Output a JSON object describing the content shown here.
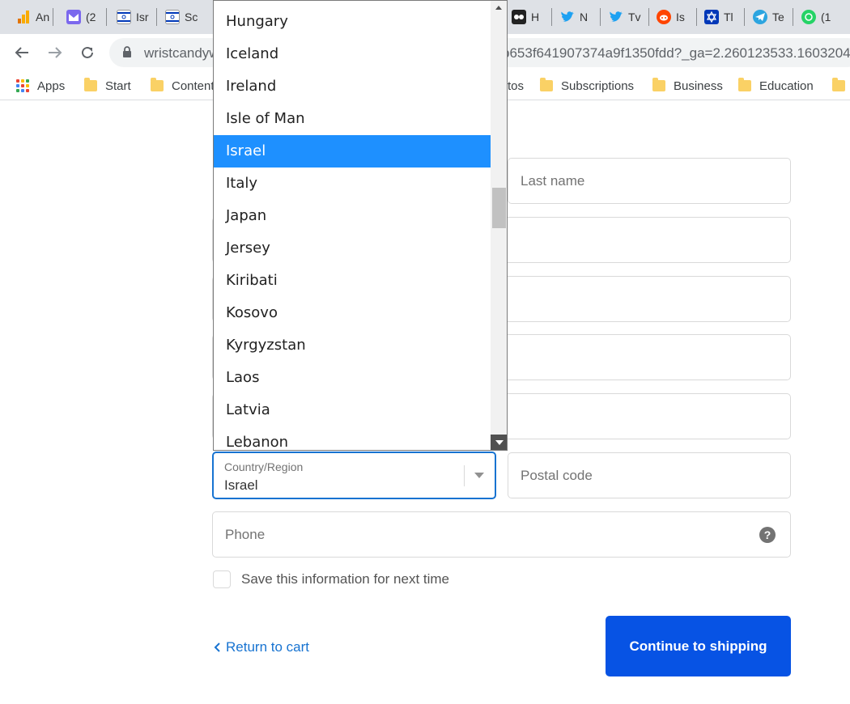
{
  "browser": {
    "tabs": [
      {
        "label": "An",
        "icon": "analytics-icon",
        "color": "#f9ab00"
      },
      {
        "label": "(2",
        "icon": "mail-icon",
        "color": "#7b68ee"
      },
      {
        "label": "Isr",
        "icon": "israel-flag-icon",
        "color": "#0038b8"
      },
      {
        "label": "Sc",
        "icon": "israel-flag-icon",
        "color": "#0038b8"
      },
      {
        "label": "H",
        "icon": "owl-icon",
        "color": "#222222"
      },
      {
        "label": "N",
        "icon": "twitter-icon",
        "color": "#1da1f2"
      },
      {
        "label": "Tv",
        "icon": "twitter-icon",
        "color": "#1da1f2"
      },
      {
        "label": "Is",
        "icon": "reddit-icon",
        "color": "#ff4500"
      },
      {
        "label": "Tl",
        "icon": "star-of-david-icon",
        "color": "#0038b8"
      },
      {
        "label": "Te",
        "icon": "telegram-icon",
        "color": "#2ca5e0"
      },
      {
        "label": "(1",
        "icon": "whatsapp-icon",
        "color": "#25d366"
      }
    ],
    "url_start": "wristcandyw",
    "url_tail": "b653f641907374a9f1350fdd?_ga=2.260123533.1603204",
    "bookmarks": [
      {
        "label": "Apps"
      },
      {
        "label": "Start"
      },
      {
        "label": "Content"
      },
      {
        "label": "tos"
      },
      {
        "label": "Subscriptions"
      },
      {
        "label": "Business"
      },
      {
        "label": "Education"
      }
    ]
  },
  "form": {
    "last_name_placeholder": "Last name",
    "country_label": "Country/Region",
    "country_value": "Israel",
    "postal_placeholder": "Postal code",
    "phone_placeholder": "Phone",
    "help_glyph": "?",
    "save_info_label": "Save this information for next time",
    "return_label": "Return to cart",
    "continue_label": "Continue to shipping"
  },
  "dropdown": {
    "options": [
      "Hungary",
      "Iceland",
      "Ireland",
      "Isle of Man",
      "Israel",
      "Italy",
      "Japan",
      "Jersey",
      "Kiribati",
      "Kosovo",
      "Kyrgyzstan",
      "Laos",
      "Latvia",
      "Lebanon"
    ],
    "selected": "Israel"
  },
  "colors": {
    "accent": "#1773d1",
    "button": "#0753e4",
    "highlight": "#1e90ff"
  }
}
